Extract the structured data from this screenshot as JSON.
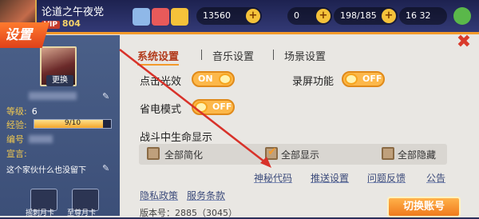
{
  "topbar": {
    "player_name": "论道之午夜党",
    "vip_label": "VIP",
    "vip_value": "804",
    "resources": [
      {
        "name": "coins",
        "value": "13560"
      },
      {
        "name": "diamonds",
        "value": "0"
      },
      {
        "name": "energy",
        "value": "198/185"
      },
      {
        "name": "stamina",
        "value": "16 32"
      }
    ]
  },
  "dialog": {
    "title": "设置",
    "close_icon": "close-icon"
  },
  "profile": {
    "change_label": "更换",
    "level_label": "等级:",
    "level_value": "6",
    "exp_label": "经验:",
    "exp_text": "9/10",
    "exp_fraction": 0.9,
    "id_label": "编号",
    "declaration_label": "宣言:",
    "motto": "这个家伙什么也没留下",
    "card_buttons": [
      "摇刺月卡",
      "至尊月卡"
    ]
  },
  "tabs": [
    {
      "label": "系统设置",
      "active": true
    },
    {
      "label": "音乐设置",
      "active": false
    },
    {
      "label": "场景设置",
      "active": false
    }
  ],
  "settings": {
    "click_effect": {
      "label": "点击光效",
      "state": "ON"
    },
    "record": {
      "label": "录屏功能",
      "state": "OFF"
    },
    "power_save": {
      "label": "省电模式",
      "state": "OFF"
    },
    "hp_title": "战斗中生命显示",
    "hp_options": [
      {
        "label": "全部简化",
        "checked": false
      },
      {
        "label": "全部显示",
        "checked": true
      },
      {
        "label": "全部隐藏",
        "checked": false
      }
    ]
  },
  "links": {
    "row1": [
      "神秘代码",
      "推送设置",
      "问题反馈",
      "公告"
    ],
    "row2": [
      "隐私政策",
      "服务条款"
    ]
  },
  "version_text": "版本号：2885（3045）",
  "switch_account_label": "切换账号",
  "colors": {
    "accent": "#f39a2b",
    "link": "#3b4a7a",
    "panel": "#3c4f78"
  }
}
